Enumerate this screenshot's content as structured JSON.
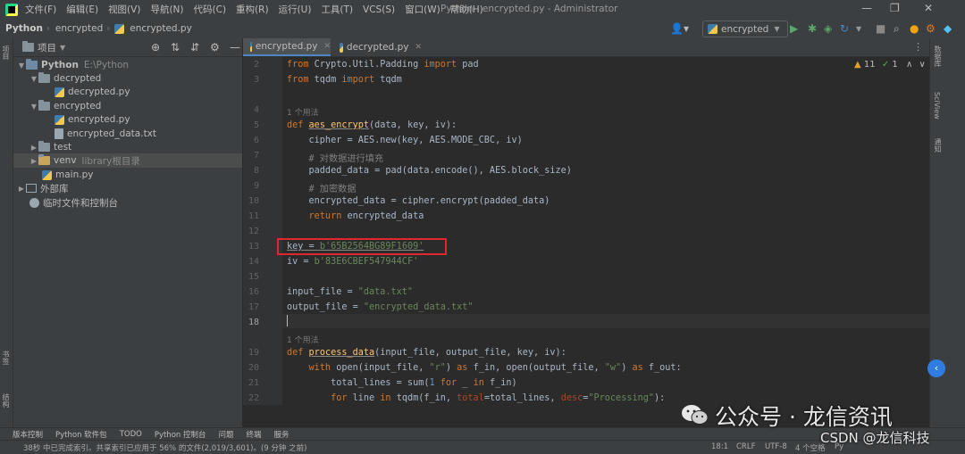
{
  "titlebar": {
    "menu": [
      "文件(F)",
      "编辑(E)",
      "视图(V)",
      "导航(N)",
      "代码(C)",
      "重构(R)",
      "运行(U)",
      "工具(T)",
      "VCS(S)",
      "窗口(W)",
      "帮助(H)"
    ],
    "title": "Python - encrypted.py - Administrator",
    "min": "—",
    "max": "❐",
    "close": "✕"
  },
  "navbar": {
    "crumbs": [
      "Python",
      "encrypted",
      "encrypted.py"
    ],
    "run_config": "encrypted"
  },
  "left_stripe": {
    "project": "项目",
    "bookmarks": "书签",
    "structure": "结构"
  },
  "project": {
    "title": "项目",
    "root": "Python",
    "root_path": "E:\\Python",
    "decrypted": "decrypted",
    "decrypted_py": "decrypted.py",
    "encrypted": "encrypted",
    "encrypted_py": "encrypted.py",
    "encrypted_data": "encrypted_data.txt",
    "test": "test",
    "venv": "venv",
    "venv_hint": "library根目录",
    "main_py": "main.py",
    "external": "外部库",
    "scratches": "临时文件和控制台"
  },
  "tabs": [
    "encrypted.py",
    "decrypted.py"
  ],
  "editor": {
    "inspection_warn": "11",
    "inspection_ok": "1",
    "usage_1": "1 个用法",
    "usage_2": "1 个用法",
    "line_numbers": [
      "2",
      "3",
      "4",
      "5",
      "6",
      "7",
      "8",
      "9",
      "10",
      "11",
      "12",
      "13",
      "14",
      "15",
      "16",
      "17",
      "18",
      "19",
      "20",
      "21",
      "22"
    ]
  },
  "code": {
    "l2a": "from ",
    "l2b": "Crypto.Util.Padding ",
    "l2c": "import ",
    "l2d": "pad",
    "l3a": "from ",
    "l3b": "tqdm ",
    "l3c": "import ",
    "l3d": "tqdm",
    "l5a": "def ",
    "l5b": "aes_encrypt",
    "l5c": "(data, key, iv):",
    "l6": "    cipher = AES.new(key, AES.MODE_CBC, iv)",
    "l7": "    # 对数据进行填充",
    "l8": "    padded_data = pad(data.encode(), AES.block_size)",
    "l9": "    # 加密数据",
    "l10": "    encrypted_data = cipher.encrypt(padded_data)",
    "l11a": "    return ",
    "l11b": "encrypted_data",
    "l13a": "key = ",
    "l13b": "b'65B2564BG89F1609'",
    "l14a": "iv = ",
    "l14b": "b'83E6CBEF547944CF'",
    "l16a": "input_file = ",
    "l16b": "\"data.txt\"",
    "l17a": "output_file = ",
    "l17b": "\"encrypted_data.txt\"",
    "l19a": "def ",
    "l19b": "process_data",
    "l19c": "(input_file, output_file, key, iv):",
    "l20a": "    with ",
    "l20b": "open(input_file, ",
    "l20c": "\"r\"",
    "l20d": ") ",
    "l20e": "as ",
    "l20f": "f_in, open(output_file, ",
    "l20g": "\"w\"",
    "l20h": ") ",
    "l20i": "as ",
    "l20j": "f_out:",
    "l21a": "        total_lines = sum(",
    "l21b": "1 ",
    "l21c": "for ",
    "l21d": "_ ",
    "l21e": "in ",
    "l21f": "f_in)",
    "l22a": "        for ",
    "l22b": "line ",
    "l22c": "in ",
    "l22d": "tqdm(f_in, ",
    "l22e": "total",
    "l22f": "=total_lines, ",
    "l22g": "desc",
    "l22h": "=",
    "l22i": "\"Processing\"",
    "l22j": "):"
  },
  "right_stripe": {
    "db": "数据库",
    "sciview": "SciView",
    "notify": "通知"
  },
  "toolwindows": [
    "版本控制",
    "Python 软件包",
    "TODO",
    "Python 控制台",
    "问题",
    "终端",
    "服务"
  ],
  "status": {
    "message": "38秒 中已完成索引。共享索引已应用于 56% 的文件(2,019/3,601)。(9 分钟 之前)",
    "position": "18:1",
    "line_sep": "CRLF",
    "encoding": "UTF-8",
    "indent": "4 个空格",
    "interp": "Py"
  },
  "watermark": {
    "wechat": "公众号 · 龙信资讯",
    "csdn": "CSDN @龙信科技"
  }
}
